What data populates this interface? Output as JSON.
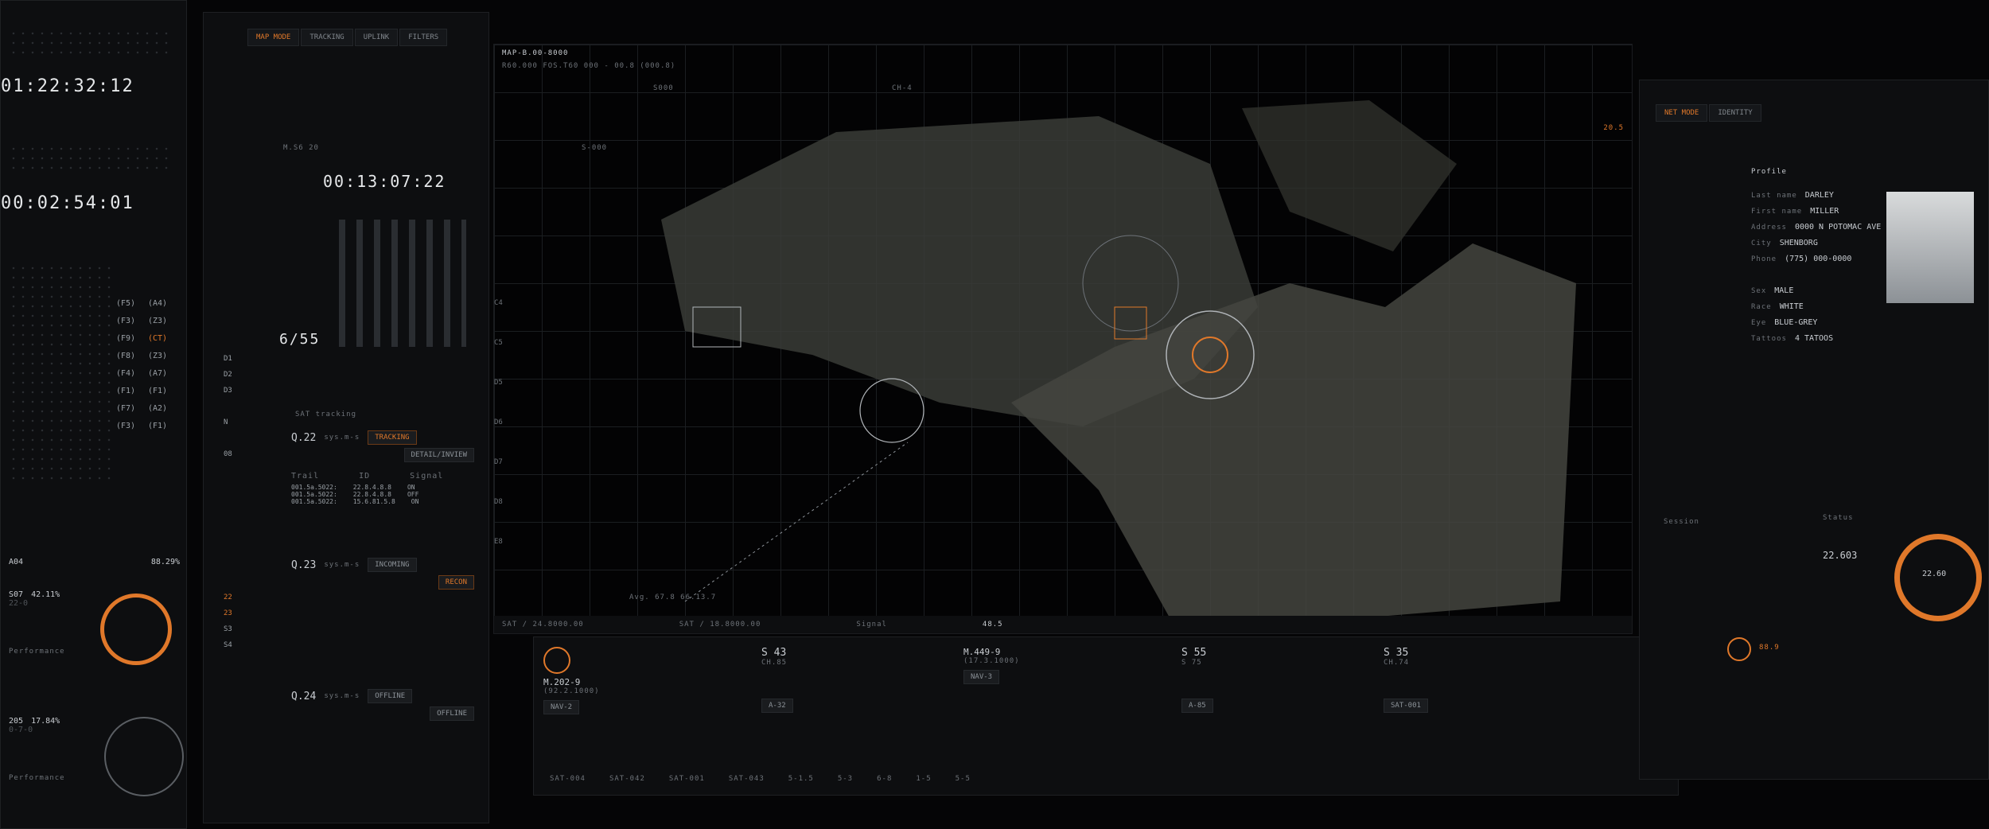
{
  "left_panel": {
    "timer_top": "01:22:32:12",
    "timer_bottom": "00:02:54:01",
    "f_codes": [
      "(F5)",
      "(F3)",
      "(F9)",
      "(F8)",
      "(F4)",
      "(F1)",
      "(F7)",
      "(F3)"
    ],
    "f_codes_right": [
      "(A4)",
      "(Z3)",
      "(CT)",
      "(Z3)",
      "(A7)",
      "(F1)",
      "(A2)",
      "(F1)"
    ],
    "a04": "A04",
    "a04_pct": "88.29%",
    "s07": "S07",
    "s07_pct": "42.11%",
    "s07_sub": "22-0",
    "performance_label": "Performance",
    "s05": "205",
    "s05_pct": "17.84%",
    "s05_sub": "0-7-0",
    "perf_label2": "Performance"
  },
  "side_panel": {
    "tabs": [
      "MAP MODE",
      "TRACKING",
      "UPLINK",
      "FILTERS"
    ],
    "ms_label": "M.S6 20",
    "timer": "00:13:07:22",
    "count": "6/55",
    "sat_tracking_title": "SAT tracking",
    "tracks": [
      {
        "id": "Q.22",
        "mode": "TRACKING",
        "sub": "DETAIL/INVIEW",
        "sys": "sys.m-s"
      },
      {
        "id": "Q.23",
        "mode": "INCOMING",
        "sub": "RECON",
        "sys": "sys.m-s"
      },
      {
        "id": "Q.24",
        "mode": "OFFLINE",
        "sub": "OFFLINE",
        "sys": "sys.m-s"
      }
    ],
    "col_trail": "Trail",
    "col_id": "ID",
    "col_signal": "Signal",
    "trail_rows": [
      {
        "trail": "001.5a.5022:",
        "id": "22.8.4.8.8",
        "signal": "ON"
      },
      {
        "trail": "001.5a.5022:",
        "id": "22.8.4.8.8",
        "signal": "OFF"
      },
      {
        "trail": "001.5a.5022:",
        "id": "15.6.81.5.8",
        "signal": "ON"
      }
    ],
    "side_letters": [
      "C4",
      "C5",
      "D5",
      "D6",
      "D7",
      "D8",
      "E8"
    ],
    "left_tags": [
      "D1",
      "D2",
      "D3",
      "N",
      "08",
      "22",
      "23",
      "S3",
      "S4"
    ]
  },
  "map": {
    "header": "MAP-B.00-8000",
    "coords": "R60.000 FOS.T60 000 - 00.8 (000.8)",
    "tags": [
      "S-000",
      "CH-4",
      "S000",
      "Avg. 67.8 66.13.7"
    ],
    "bottom_bar": [
      "SAT / 24.8000.00",
      "SAT / 18.8000.00",
      "Signal",
      "48.5"
    ],
    "right_scale": "20.5"
  },
  "bottom_strip": {
    "cells": [
      {
        "title": "M.202-9",
        "sub": "(92.2.1000)",
        "code": "NAV-2"
      },
      {
        "title": "S 43",
        "sub": "CH.85",
        "code": "A-32"
      },
      {
        "title": "M.449-9",
        "sub": "(17.3.1000)",
        "code": "NAV-3"
      },
      {
        "title": "S 55",
        "sub": "S 75",
        "code": "A-85"
      },
      {
        "title": "S 35",
        "sub": "CH.74",
        "code": "SAT-001"
      }
    ],
    "labels": [
      "SAT-004",
      "SAT-042",
      "SAT-001",
      "SAT-043"
    ],
    "values": [
      "5-1.5",
      "5-3",
      "6-8",
      "1-5",
      "5-5"
    ]
  },
  "right_panel": {
    "tabs": [
      "NET MODE",
      "IDENTITY"
    ],
    "profile_title": "Profile",
    "fields": [
      {
        "k": "Last name",
        "v": "DARLEY"
      },
      {
        "k": "First name",
        "v": "MILLER"
      },
      {
        "k": "Address",
        "v": "0000 N POTOMAC AVE"
      },
      {
        "k": "City",
        "v": "SHENBORG"
      },
      {
        "k": "Phone",
        "v": "(775) 000-0000"
      },
      {
        "k": "Sex",
        "v": "MALE"
      },
      {
        "k": "Race",
        "v": "WHITE"
      },
      {
        "k": "Eye",
        "v": "BLUE-GREY"
      },
      {
        "k": "Tattoos",
        "v": "4 TATOOS"
      }
    ],
    "session_label": "Session",
    "status_label": "Status",
    "status_value": "22.603",
    "gauge_value": "88.9",
    "dial_value": "22.60",
    "accent": "#e0782a"
  }
}
